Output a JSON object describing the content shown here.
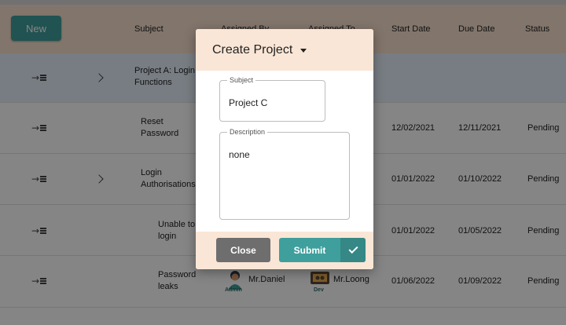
{
  "toolbar": {
    "new_label": "New"
  },
  "table": {
    "headers": {
      "subject": "Subject",
      "assigned_by": "Assigned By",
      "assigned_to": "Assigned To",
      "start_date": "Start Date",
      "due_date": "Due Date",
      "status": "Status"
    },
    "rows": [
      {
        "subject": "Project A: Login Functions",
        "expandable": true
      },
      {
        "subject": "Reset Password",
        "start_date": "12/02/2021",
        "due_date": "12/11/2021",
        "status": "Pending"
      },
      {
        "subject": "Login Authorisations",
        "expandable": true,
        "start_date": "01/01/2022",
        "due_date": "01/10/2022",
        "status": "Pending"
      },
      {
        "subject": "Unable to login",
        "start_date": "01/01/2022",
        "due_date": "01/05/2022",
        "status": "Pending"
      },
      {
        "subject": "Password leaks",
        "assigned_by": "Mr.Daniel",
        "assigned_by_badge": "Admin",
        "assigned_to": "Mr.Loong",
        "assigned_to_badge": "Dev",
        "start_date": "01/06/2022",
        "due_date": "01/09/2022",
        "status": "Pending"
      }
    ]
  },
  "modal": {
    "title": "Create Project",
    "subject_label": "Subject",
    "subject_value": "Project C",
    "description_label": "Description",
    "description_value": "none",
    "close_label": "Close",
    "submit_label": "Submit"
  },
  "colors": {
    "accent": "#3f9f9c",
    "header_bg": "#f9e1cd",
    "highlight_row": "#e6f0fb",
    "close_button": "#6e6e6e"
  }
}
